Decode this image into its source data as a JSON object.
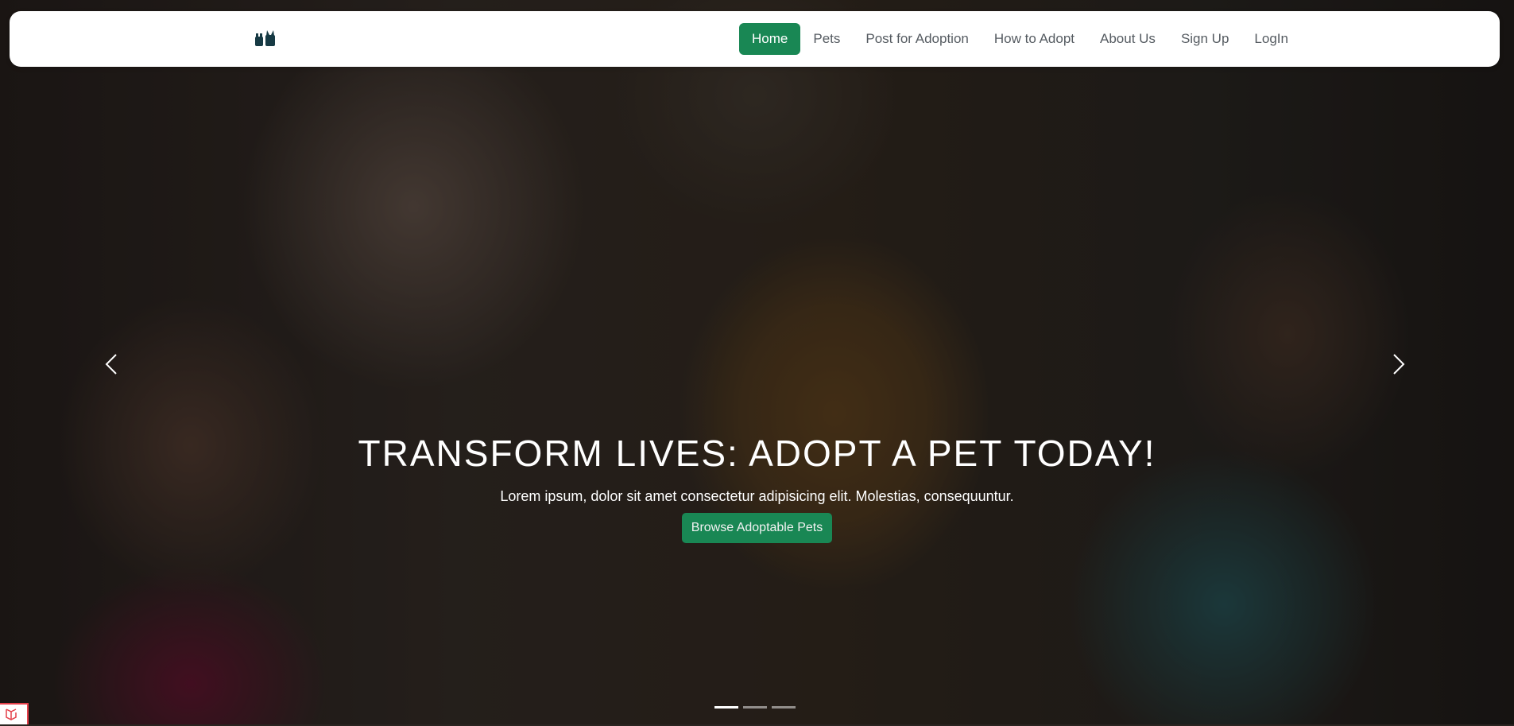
{
  "navbar": {
    "logo_icon": "paw-pets-logo-icon",
    "items": [
      {
        "label": "Home",
        "active": true
      },
      {
        "label": "Pets",
        "active": false
      },
      {
        "label": "Post for Adoption",
        "active": false
      },
      {
        "label": "How to Adopt",
        "active": false
      },
      {
        "label": "About Us",
        "active": false
      },
      {
        "label": "Sign Up",
        "active": false
      },
      {
        "label": "LogIn",
        "active": false
      }
    ]
  },
  "hero": {
    "title": "TRANSFORM LIVES: ADOPT A PET TODAY!",
    "subtitle": "Lorem ipsum, dolor sit amet consectetur adipisicing elit. Molestias, consequuntur.",
    "cta_label": "Browse Adoptable Pets",
    "prev_icon": "chevron-left-icon",
    "next_icon": "chevron-right-icon",
    "slides_count": 3,
    "active_slide": 1
  },
  "colors": {
    "accent": "#198754",
    "nav_text": "#555b61",
    "caption_text": "#ffffff"
  },
  "corner_badge_icon": "laravel-icon"
}
